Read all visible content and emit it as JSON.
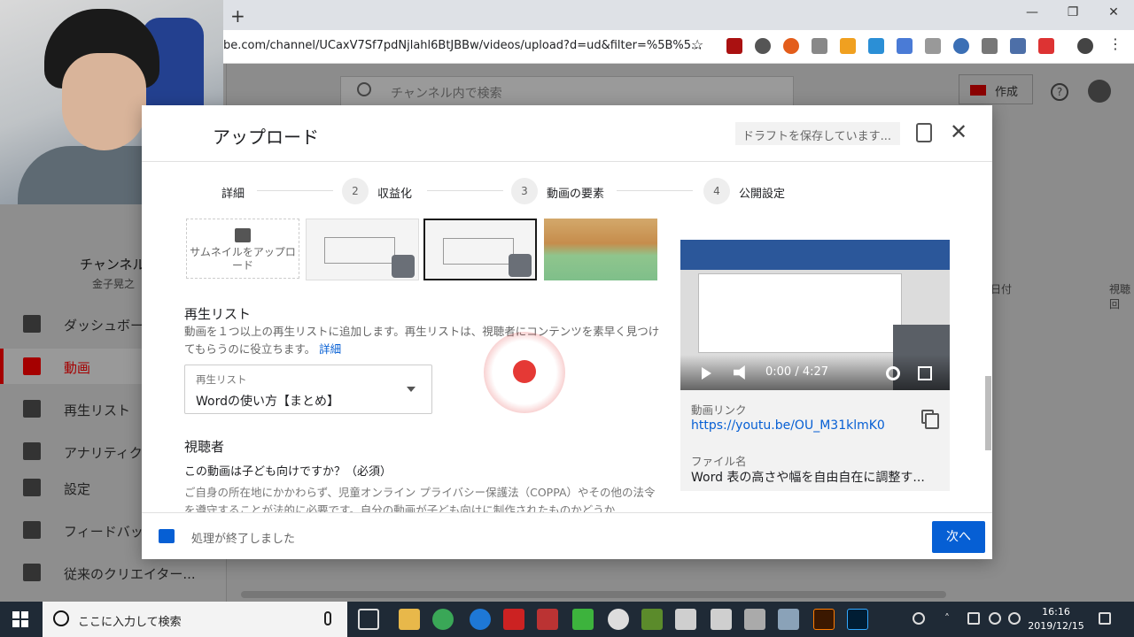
{
  "browser": {
    "new_tab": "+",
    "url": "be.com/channel/UCaxV7Sf7pdNjlahl6BtJBBw/videos/upload?d=ud&filter=%5B%5...",
    "window_controls": [
      "—",
      "❐",
      "✕"
    ]
  },
  "studio": {
    "search_placeholder": "チャンネル内で検索",
    "create_label": "作成",
    "channel_name": "チャンネル",
    "channel_sub": "金子晃之",
    "nav": [
      {
        "label": "ダッシュボー",
        "icon": "dashboard-icon"
      },
      {
        "label": "動画",
        "icon": "video-icon",
        "active": true
      },
      {
        "label": "再生リスト",
        "icon": "playlist-icon"
      },
      {
        "label": "アナリティク",
        "icon": "analytics-icon"
      },
      {
        "label": "設定",
        "icon": "settings-icon"
      },
      {
        "label": "フィードバッ",
        "icon": "feedback-icon"
      },
      {
        "label": "従来のクリエイター...",
        "icon": "classic-icon"
      }
    ],
    "col_date": "日付",
    "col_views": "視聴回"
  },
  "dialog": {
    "title": "アップロード",
    "draft_status": "ドラフトを保存しています...",
    "steps": [
      {
        "num": "",
        "label": "詳細"
      },
      {
        "num": "2",
        "label": "収益化"
      },
      {
        "num": "3",
        "label": "動画の要素"
      },
      {
        "num": "4",
        "label": "公開設定"
      }
    ],
    "thumbnail_upload": "サムネイルをアップロード",
    "playlist": {
      "title": "再生リスト",
      "description": "動画を１つ以上の再生リストに追加します。再生リストは、視聴者にコンテンツを素早く見つけてもらうのに役立ちます。",
      "learn_more": "詳細",
      "select_label": "再生リスト",
      "select_value": "Wordの使い方【まとめ】"
    },
    "audience": {
      "title": "視聴者",
      "question": "この動画は子ども向けですか？（必須）",
      "description": "ご自身の所在地にかかわらず、児童オンライン プライバシー保護法（COPPA）やその他の法令を遵守することが法的に必要です。自分の動画が子ども向けに制作されたものかどうか"
    },
    "preview": {
      "time": "0:00 / 4:27",
      "link_label": "動画リンク",
      "link": "https://youtu.be/OU_M31klmK0",
      "file_label": "ファイル名",
      "file": "Word 表の高さや幅を自由自在に調整す..."
    },
    "footer_status": "処理が終了しました",
    "next_button": "次へ"
  },
  "taskbar": {
    "search_text": "ここに入力して検索",
    "time": "16:16",
    "date": "2019/12/15"
  }
}
